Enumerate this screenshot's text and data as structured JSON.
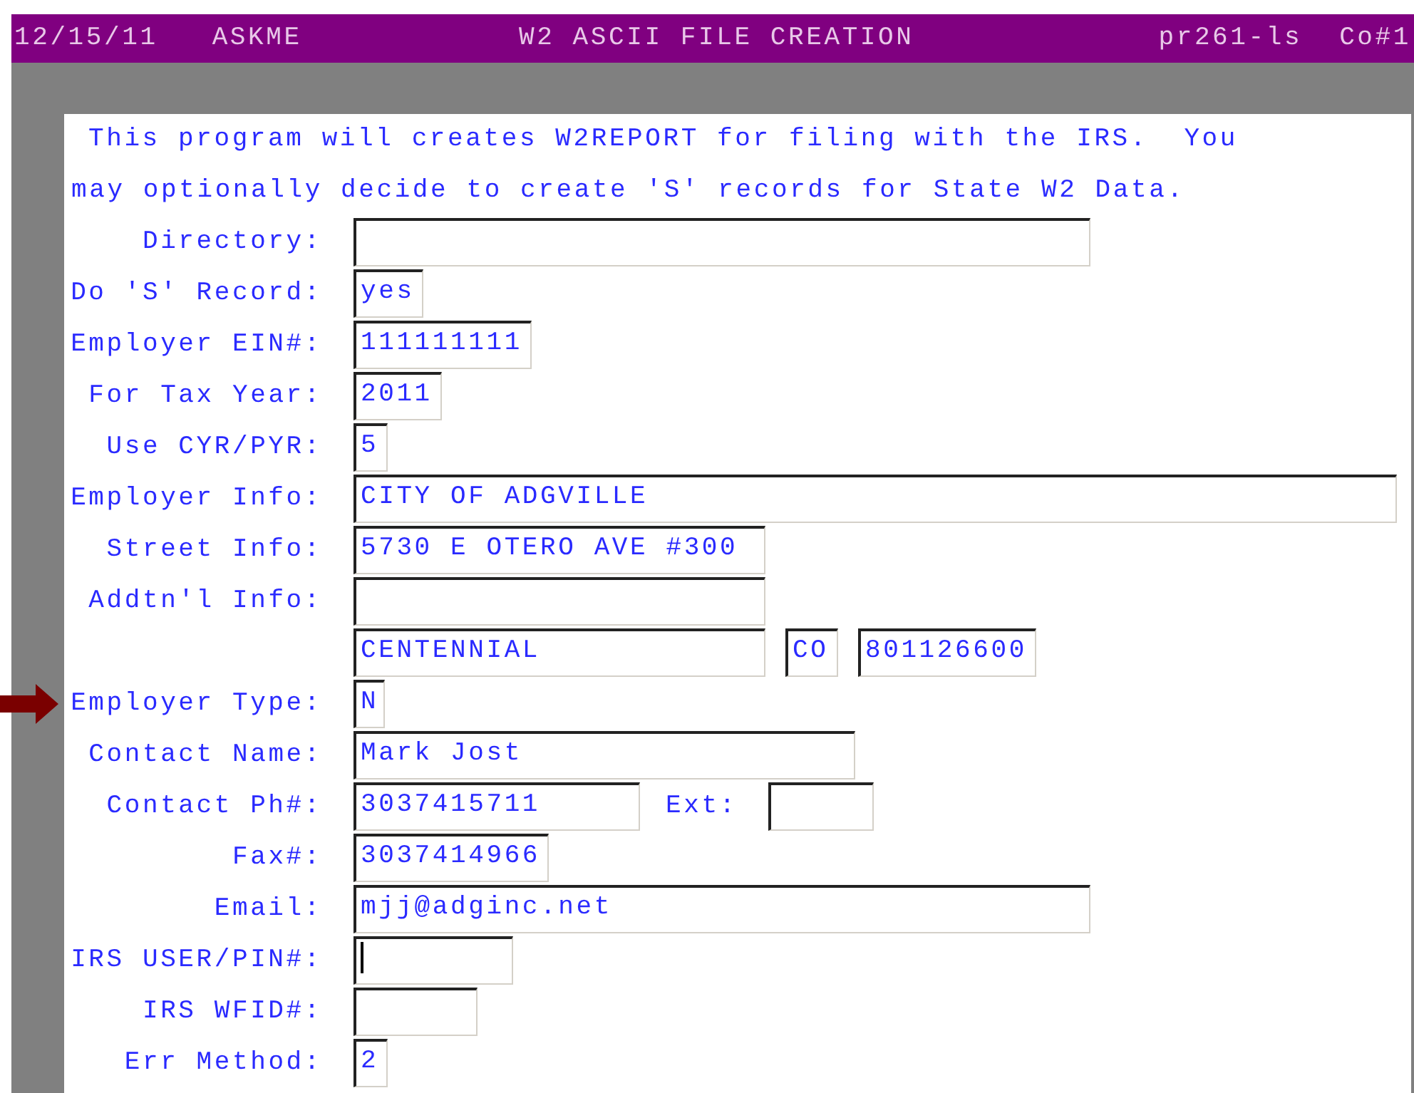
{
  "title_bar": {
    "date": "12/15/11",
    "user": "ASKME",
    "title": "W2 ASCII FILE CREATION",
    "program_id": "pr261-ls",
    "company": "Co#1"
  },
  "intro_lines": [
    "This program will creates W2REPORT for filing with the IRS.  You",
    "may optionally decide to create 'S' records for State W2 Data."
  ],
  "rows": [
    {
      "label": "Directory:",
      "marked": false,
      "items": [
        {
          "kind": "field",
          "value": "",
          "focused": false
        }
      ]
    },
    {
      "label": "Do 'S' Record:",
      "marked": false,
      "items": [
        {
          "kind": "field",
          "value": "yes",
          "focused": false
        }
      ]
    },
    {
      "label": "Employer EIN#:",
      "marked": false,
      "items": [
        {
          "kind": "field",
          "value": "111111111",
          "focused": false
        }
      ]
    },
    {
      "label": "For Tax Year:",
      "marked": false,
      "items": [
        {
          "kind": "field",
          "value": "2011",
          "focused": false
        }
      ]
    },
    {
      "label": "Use CYR/PYR:",
      "marked": false,
      "items": [
        {
          "kind": "field",
          "value": "5",
          "focused": false
        }
      ]
    },
    {
      "label": "Employer Info:",
      "marked": false,
      "items": [
        {
          "kind": "field",
          "value": "CITY OF ADGVILLE",
          "focused": false
        }
      ]
    },
    {
      "label": "Street Info:",
      "marked": false,
      "items": [
        {
          "kind": "field",
          "value": "5730 E OTERO AVE #300",
          "focused": false
        }
      ]
    },
    {
      "label": "Addtn'l Info:",
      "marked": false,
      "items": [
        {
          "kind": "field",
          "value": "",
          "focused": false
        }
      ]
    },
    {
      "label": "",
      "marked": false,
      "items": [
        {
          "kind": "field",
          "value": "CENTENNIAL",
          "focused": false
        },
        {
          "kind": "field",
          "value": "CO",
          "focused": false
        },
        {
          "kind": "field",
          "value": "801126600",
          "focused": false
        }
      ]
    },
    {
      "label": "Employer Type:",
      "marked": true,
      "items": [
        {
          "kind": "field",
          "value": "N",
          "focused": false
        }
      ]
    },
    {
      "label": "Contact Name:",
      "marked": false,
      "items": [
        {
          "kind": "field",
          "value": "Mark Jost",
          "focused": false
        }
      ]
    },
    {
      "label": "Contact Ph#:",
      "marked": false,
      "items": [
        {
          "kind": "field",
          "value": "3037415711",
          "focused": false
        },
        {
          "kind": "label",
          "text": "Ext:"
        },
        {
          "kind": "field",
          "value": "",
          "focused": false
        }
      ]
    },
    {
      "label": "Fax#:",
      "marked": false,
      "items": [
        {
          "kind": "field",
          "value": "3037414966",
          "focused": false
        }
      ]
    },
    {
      "label": "Email:",
      "marked": false,
      "items": [
        {
          "kind": "field",
          "value": "mjj@adginc.net",
          "focused": false
        }
      ]
    },
    {
      "label": "IRS USER/PIN#:",
      "marked": false,
      "items": [
        {
          "kind": "field",
          "value": "",
          "focused": true
        }
      ]
    },
    {
      "label": "IRS WFID#:",
      "marked": false,
      "items": [
        {
          "kind": "field",
          "value": "",
          "focused": false
        }
      ]
    },
    {
      "label": "Err Method:",
      "marked": false,
      "items": [
        {
          "kind": "field",
          "value": "2",
          "focused": false
        }
      ]
    }
  ]
}
